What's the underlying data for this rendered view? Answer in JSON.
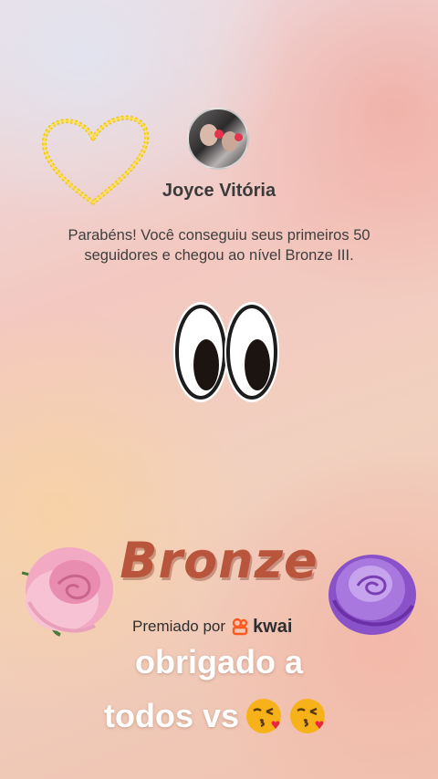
{
  "profile": {
    "name": "Joyce Vitória",
    "avatar_icon": "profile-photo"
  },
  "achievement": {
    "message": "Parabéns! Você conseguiu seus primeiros 50 seguidores e chegou ao nível Bronze III.",
    "level_title": "Bronze",
    "award_text": "Premiado por",
    "brand": "kwai"
  },
  "caption": {
    "line1": "obrigado a",
    "line2": "todos vs",
    "emojis": [
      "kissing-face-icon",
      "kissing-face-icon"
    ]
  },
  "colors": {
    "bronze": "#b8553c",
    "kwai_orange": "#ff5a1f",
    "caption_text": "#ffffff"
  }
}
